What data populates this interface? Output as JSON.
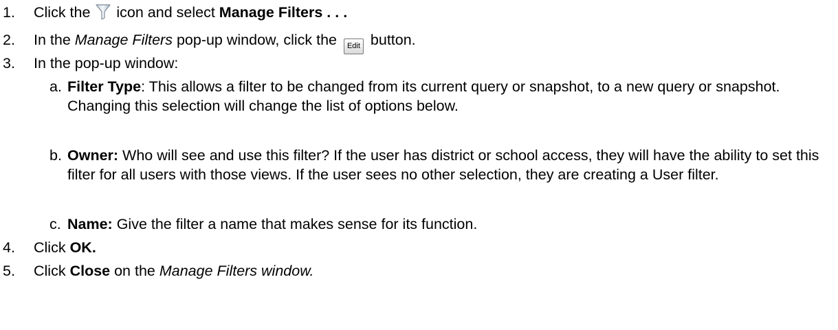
{
  "steps": [
    {
      "num": "1.",
      "t1": "Click the ",
      "icon": "filter-funnel-icon",
      "t2": " icon and select ",
      "bold": "Manage Filters . . ."
    },
    {
      "num": "2.",
      "t1": "In the ",
      "italic": "Manage Filters",
      "t2": " pop-up window, click the ",
      "button_label": "Edit",
      "t3": " button."
    },
    {
      "num": "3.",
      "text": "In the pop-up window:",
      "subitems": [
        {
          "letter": "a.",
          "bold": "Filter Type",
          "text": ":  This allows a filter to be changed from its current query or snapshot, to a new query or snapshot.  Changing this selection will change the list of options below."
        },
        {
          "letter": "b.",
          "bold": "Owner:",
          "text": "  Who will see and use this filter?  If the user has district or school access, they will have the ability to set this filter for all users with those views.  If the user sees no other selection, they are creating a User filter."
        },
        {
          "letter": "c.",
          "bold": "Name:",
          "text": "  Give the filter a name that makes sense for its function."
        }
      ]
    },
    {
      "num": "4.",
      "t1": "Click ",
      "bold": "OK."
    },
    {
      "num": "5.",
      "t1": "Click ",
      "bold": "Close",
      "t2": " on the ",
      "italic": "Manage Filters window."
    }
  ]
}
